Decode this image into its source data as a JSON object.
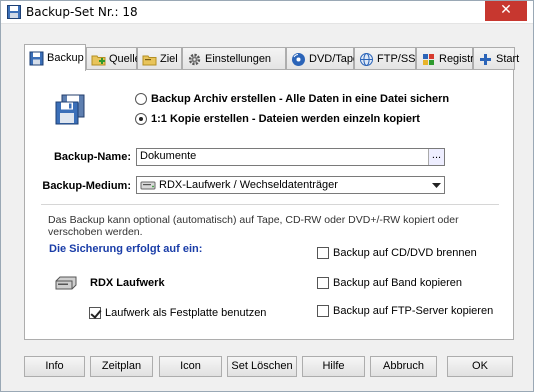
{
  "window": {
    "title": "Backup-Set Nr.: 18",
    "close_label": "✕"
  },
  "tabs": [
    {
      "label": "Backup",
      "icon": "floppy-icon",
      "active": true
    },
    {
      "label": "Quelle",
      "icon": "folder-add-icon",
      "active": false
    },
    {
      "label": "Ziel",
      "icon": "folder-icon",
      "active": false
    },
    {
      "label": "Einstellungen",
      "icon": "gear-icon",
      "active": false
    },
    {
      "label": "DVD/Tape",
      "icon": "disc-icon",
      "active": false
    },
    {
      "label": "FTP/SSH",
      "icon": "globe-icon",
      "active": false
    },
    {
      "label": "Registry",
      "icon": "registry-icon",
      "active": false
    },
    {
      "label": "Start",
      "icon": "plus-icon",
      "active": false
    }
  ],
  "mode": {
    "option1": "Backup Archiv erstellen - Alle Daten in eine Datei sichern",
    "option2": "1:1 Kopie erstellen - Dateien werden einzeln kopiert",
    "selected": "option2"
  },
  "backup_name": {
    "label": "Backup-Name:",
    "value": "Dokumente",
    "browse_label": "..."
  },
  "backup_medium": {
    "label": "Backup-Medium:",
    "value": "RDX-Laufwerk / Wechseldatenträger"
  },
  "info_text": "Das Backup kann optional (automatisch) auf Tape, CD-RW oder DVD+/-RW kopiert oder verschoben werden.",
  "target": {
    "heading": "Die Sicherung erfolgt auf ein:",
    "drive_label": "RDX Laufwerk",
    "fixed_disk_label": "Laufwerk als Festplatte benutzen",
    "fixed_disk_checked": true,
    "cd_dvd_label": "Backup auf CD/DVD brennen",
    "cd_dvd_checked": false,
    "tape_label": "Backup auf Band kopieren",
    "tape_checked": false,
    "ftp_label": "Backup auf FTP-Server kopieren",
    "ftp_checked": false
  },
  "buttons": {
    "info": "Info",
    "schedule": "Zeitplan",
    "icon": "Icon",
    "delete_set": "Set Löschen",
    "help": "Hilfe",
    "cancel": "Abbruch",
    "ok": "OK"
  },
  "colors": {
    "accent_blue": "#1a3da8",
    "close_red": "#c7372f"
  }
}
